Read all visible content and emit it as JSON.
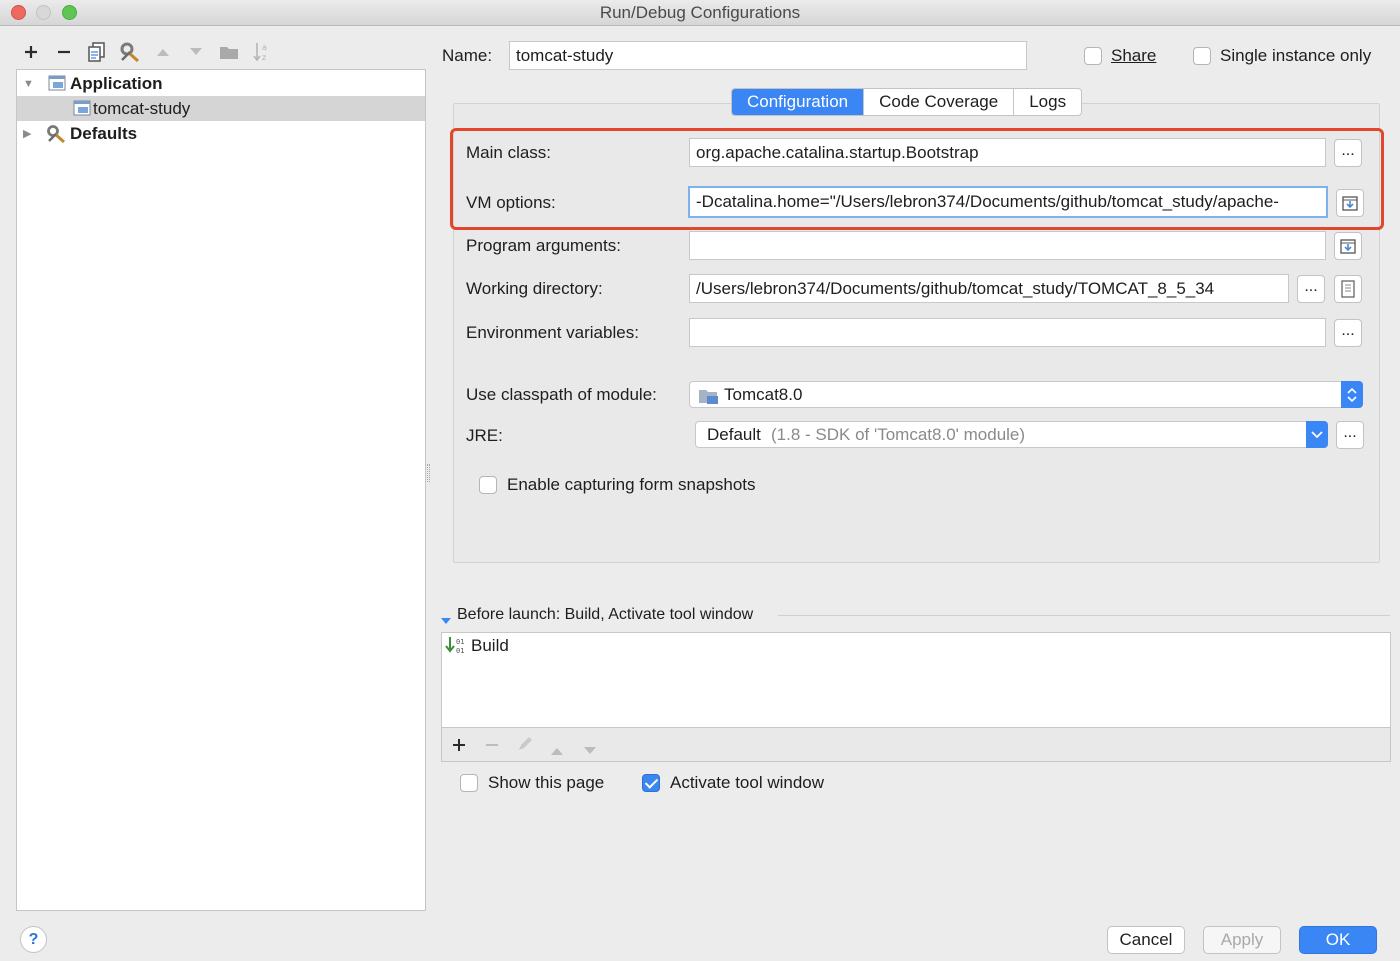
{
  "window": {
    "title": "Run/Debug Configurations",
    "traffic_lights": {
      "close": "#ed6a5e",
      "minimize": "#d8d8d8",
      "zoom": "#61c554"
    }
  },
  "left_toolbar": {
    "icons": [
      "add-icon",
      "remove-icon",
      "copy-icon",
      "edit-defaults-icon",
      "move-up-icon",
      "move-down-icon",
      "folder-icon",
      "sort-icon"
    ]
  },
  "tree": {
    "items": [
      {
        "label": "Application",
        "expanded": true,
        "icon": "application-icon"
      },
      {
        "label": "tomcat-study",
        "selected": true,
        "icon": "run-config-icon"
      },
      {
        "label": "Defaults",
        "expanded": false,
        "icon": "defaults-icon"
      }
    ]
  },
  "header": {
    "name_label": "Name:",
    "name_value": "tomcat-study",
    "share_label": "Share",
    "share_checked": false,
    "single_instance_label": "Single instance only",
    "single_instance_checked": false
  },
  "tabs": [
    {
      "label": "Configuration",
      "active": true
    },
    {
      "label": "Code Coverage",
      "active": false
    },
    {
      "label": "Logs",
      "active": false
    }
  ],
  "form": {
    "main_class_label": "Main class:",
    "main_class_value": "org.apache.catalina.startup.Bootstrap",
    "vm_options_label": "VM options:",
    "vm_options_value": "-Dcatalina.home=\"/Users/lebron374/Documents/github/tomcat_study/apache-",
    "program_args_label": "Program arguments:",
    "program_args_value": "",
    "working_dir_label": "Working directory:",
    "working_dir_value": "/Users/lebron374/Documents/github/tomcat_study/TOMCAT_8_5_34",
    "env_vars_label": "Environment variables:",
    "env_vars_value": "",
    "classpath_label": "Use classpath of module:",
    "classpath_value": "Tomcat8.0",
    "jre_label": "JRE:",
    "jre_value": "Default",
    "jre_detail": "(1.8 - SDK of 'Tomcat8.0' module)",
    "snapshots_label": "Enable capturing form snapshots",
    "snapshots_checked": false,
    "ellipsis": "..."
  },
  "before_launch": {
    "title": "Before launch: Build, Activate tool window",
    "items": [
      "Build"
    ],
    "show_page_label": "Show this page",
    "show_page_checked": false,
    "activate_label": "Activate tool window",
    "activate_checked": true
  },
  "buttons": {
    "help": "?",
    "cancel": "Cancel",
    "apply": "Apply",
    "ok": "OK"
  },
  "colors": {
    "accent": "#3a86f5",
    "highlight_border": "#e2472d"
  }
}
